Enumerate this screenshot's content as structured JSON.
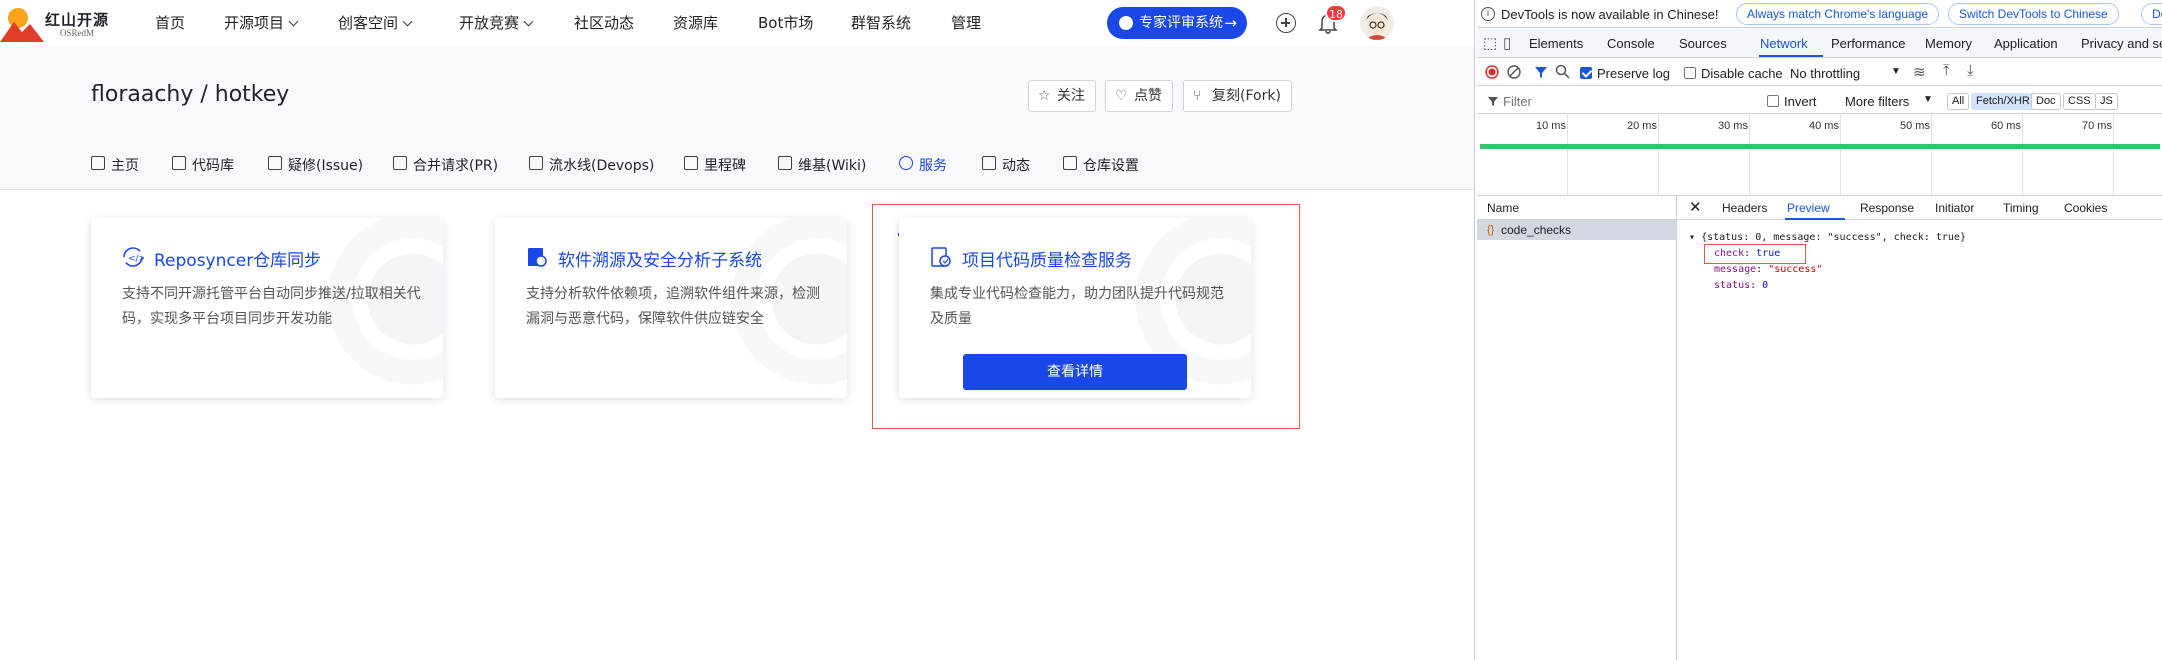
{
  "brand": {
    "name": "红山开源",
    "sub": "OSRedM"
  },
  "nav": {
    "items": [
      {
        "label": "首页",
        "dropdown": false
      },
      {
        "label": "开源项目",
        "dropdown": true
      },
      {
        "label": "创客空间",
        "dropdown": true
      },
      {
        "label": "开放竞赛",
        "dropdown": true
      },
      {
        "label": "社区动态",
        "dropdown": false
      },
      {
        "label": "资源库",
        "dropdown": false
      },
      {
        "label": "Bot市场",
        "dropdown": false
      },
      {
        "label": "群智系统",
        "dropdown": false
      },
      {
        "label": "管理",
        "dropdown": false
      }
    ],
    "expert_button": "专家评审系统",
    "expert_arrow": "→",
    "notification_count": "18"
  },
  "repo": {
    "title": "floraachy / hotkey",
    "actions": {
      "watch": "关注",
      "star": "点赞",
      "fork": "复刻(Fork)"
    },
    "tabs": [
      "主页",
      "代码库",
      "疑修(Issue)",
      "合并请求(PR)",
      "流水线(Devops)",
      "里程碑",
      "维基(Wiki)",
      "服务",
      "动态",
      "仓库设置"
    ],
    "active_tab": "服务"
  },
  "cards": [
    {
      "title": "Reposyncer仓库同步",
      "desc": "支持不同开源托管平台自动同步推送/拉取相关代码，实现多平台项目同步开发功能"
    },
    {
      "title": "软件溯源及安全分析子系统",
      "desc": "支持分析软件依赖项，追溯软件组件来源，检测漏洞与恶意代码，保障软件供应链安全"
    },
    {
      "title": "项目代码质量检查服务",
      "desc": "集成专业代码检查能力，助力团队提升代码规范及质量",
      "button": "查看详情"
    }
  ],
  "devtools": {
    "info_text": "DevTools is now available in Chinese!",
    "info_btn1": "Always match Chrome's language",
    "info_btn2": "Switch DevTools to Chinese",
    "info_btn3": "Don't",
    "tabs": [
      "Elements",
      "Console",
      "Sources",
      "Network",
      "Performance",
      "Memory",
      "Application",
      "Privacy and se"
    ],
    "active_tab": "Network",
    "toolbar": {
      "preserve_log": "Preserve log",
      "preserve_checked": true,
      "disable_cache": "Disable cache",
      "disable_checked": false,
      "throttling": "No throttling"
    },
    "filter": {
      "placeholder": "Filter",
      "invert": "Invert",
      "more": "More filters",
      "chips": [
        "All",
        "Fetch/XHR",
        "Doc",
        "CSS",
        "JS"
      ],
      "active_chip": "Fetch/XHR"
    },
    "timeline": {
      "ticks": [
        "10 ms",
        "20 ms",
        "30 ms",
        "40 ms",
        "50 ms",
        "60 ms",
        "70 ms"
      ]
    },
    "list_header": "Name",
    "request": "code_checks",
    "pane_tabs": [
      "Headers",
      "Preview",
      "Response",
      "Initiator",
      "Timing",
      "Cookies"
    ],
    "active_pane_tab": "Preview",
    "json": {
      "summary": "{status: 0, message: \"success\", check: true}",
      "check_key": "check",
      "check_val": "true",
      "message_key": "message",
      "message_val": "\"success\"",
      "status_key": "status",
      "status_val": "0"
    }
  }
}
